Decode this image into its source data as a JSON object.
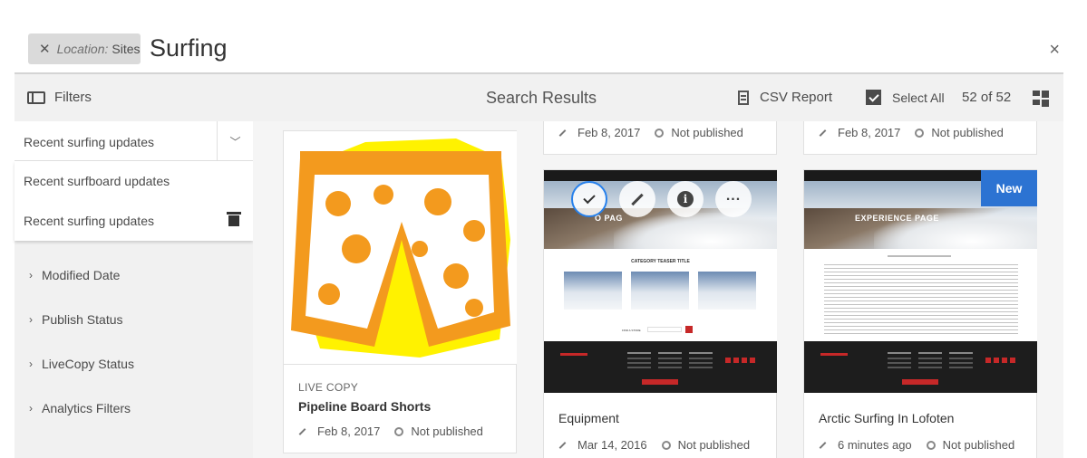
{
  "search": {
    "tag_key": "Location:",
    "tag_value": "Sites",
    "query": "Surfing",
    "close": "×"
  },
  "toolbar": {
    "filters_label": "Filters",
    "title": "Search Results",
    "csv_label": "CSV Report",
    "select_all_label": "Select All",
    "count": "52 of 52"
  },
  "rail": {
    "selected_search": "Recent surfing updates",
    "saved_searches": [
      "Recent surfboard updates",
      "Recent surfing updates"
    ],
    "facets": [
      "Modified Date",
      "Publish Status",
      "LiveCopy Status",
      "Analytics Filters"
    ]
  },
  "cards": {
    "top_mid": {
      "date": "Feb 8, 2017",
      "status": "Not published"
    },
    "top_right": {
      "date": "Feb 8, 2017",
      "status": "Not published"
    },
    "shorts": {
      "type": "LIVE COPY",
      "title": "Pipeline Board Shorts",
      "date": "Feb 8, 2017",
      "status": "Not published"
    },
    "equipment": {
      "title": "Equipment",
      "date": "Mar 14, 2016",
      "status": "Not published",
      "thumb_title": "CATEGORY TEASER TITLE",
      "thumb_hero": "O PAG",
      "thumb_store": "FIND A STORE"
    },
    "arctic": {
      "title": "Arctic Surfing In Lofoten",
      "date": "6 minutes ago",
      "status": "Not published",
      "badge": "New",
      "thumb_hero": "EXPERIENCE PAGE"
    }
  },
  "colors": {
    "accent_blue": "#2c73d2",
    "selection_ring": "#2680eb",
    "brand_red": "#c62828",
    "shorts_orange": "#f39a1e",
    "highlight_yellow": "#fff200"
  }
}
